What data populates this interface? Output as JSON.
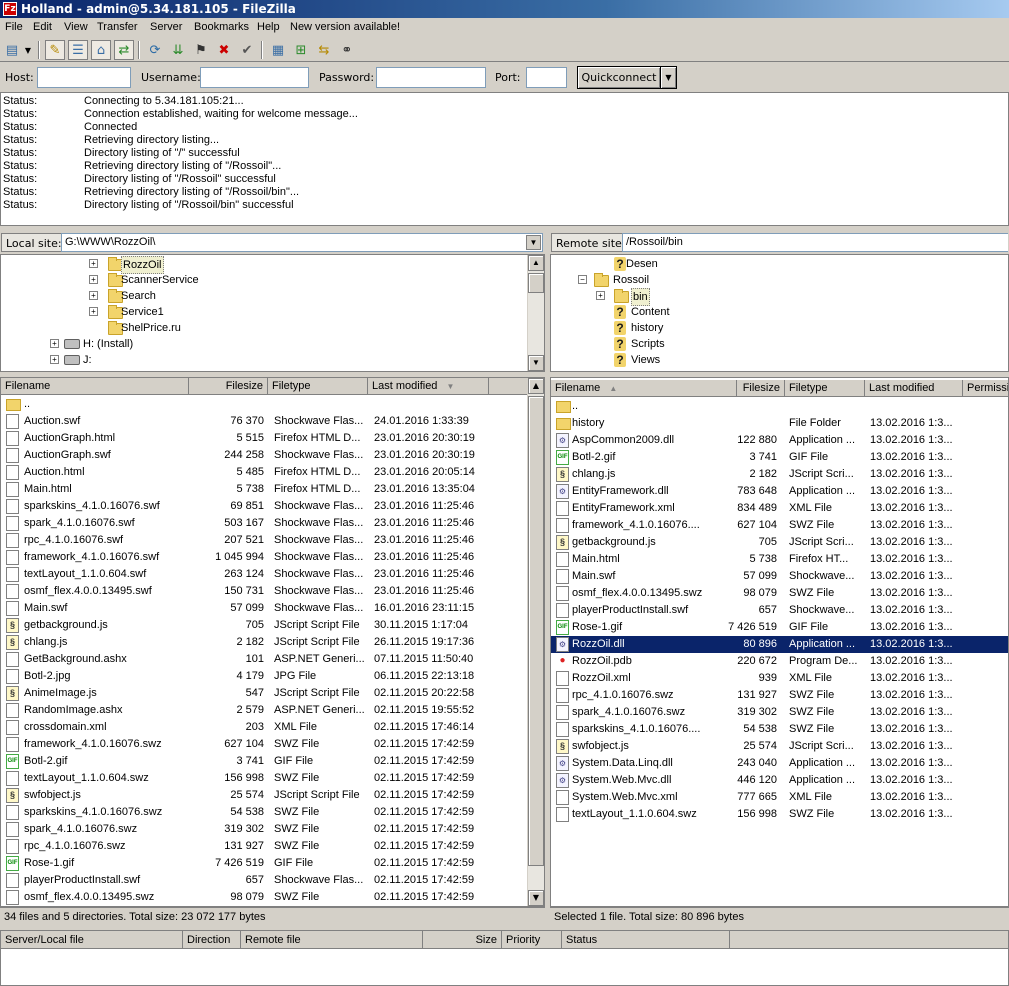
{
  "window": {
    "title": "Holland - admin@5.34.181.105 - FileZilla",
    "icon": "filezilla-icon"
  },
  "menu": [
    "File",
    "Edit",
    "View",
    "Transfer",
    "Server",
    "Bookmarks",
    "Help",
    "New version available!"
  ],
  "toolbar": {
    "icons": [
      "site-manager-icon",
      "dropdown-icon",
      "message-log-icon",
      "local-tree-icon",
      "remote-tree-icon",
      "transfer-queue-icon",
      "refresh-icon",
      "process-queue-icon",
      "cancel-icon",
      "disconnect-icon",
      "reconnect-icon",
      "directory-listing-filters-icon",
      "compare-icon",
      "sync-browse-icon",
      "find-icon"
    ]
  },
  "quickconnect": {
    "host_label": "Host:",
    "host_value": "",
    "username_label": "Username:",
    "username_value": "",
    "password_label": "Password:",
    "password_value": "",
    "port_label": "Port:",
    "port_value": "",
    "button_label": "Quickconnect"
  },
  "log": [
    {
      "key": "Status:",
      "msg": "Connecting to 5.34.181.105:21..."
    },
    {
      "key": "Status:",
      "msg": "Connection established, waiting for welcome message..."
    },
    {
      "key": "Status:",
      "msg": "Connected"
    },
    {
      "key": "Status:",
      "msg": "Retrieving directory listing..."
    },
    {
      "key": "Status:",
      "msg": "Directory listing of \"/\" successful"
    },
    {
      "key": "Status:",
      "msg": "Retrieving directory listing of \"/Rossoil\"..."
    },
    {
      "key": "Status:",
      "msg": "Directory listing of \"/Rossoil\" successful"
    },
    {
      "key": "Status:",
      "msg": "Retrieving directory listing of \"/Rossoil/bin\"..."
    },
    {
      "key": "Status:",
      "msg": "Directory listing of \"/Rossoil/bin\" successful"
    }
  ],
  "local": {
    "site_label": "Local site:",
    "path": "G:\\WWW\\RozzOil\\",
    "tree": [
      {
        "label": "RozzOil",
        "type": "folder",
        "expander": "+",
        "selected": true
      },
      {
        "label": "ScannerService",
        "type": "folder",
        "expander": "+"
      },
      {
        "label": "Search",
        "type": "folder",
        "expander": "+"
      },
      {
        "label": "Service1",
        "type": "folder",
        "expander": "+"
      },
      {
        "label": "ShelPrice.ru",
        "type": "folder",
        "expander": ""
      },
      {
        "label": "H: (Install)",
        "type": "drive",
        "expander": "+"
      },
      {
        "label": "J:",
        "type": "drive",
        "expander": "+"
      }
    ],
    "columns": [
      "Filename",
      "Filesize",
      "Filetype",
      "Last modified"
    ],
    "files": [
      {
        "name": "..",
        "size": "",
        "type": "",
        "modified": "",
        "icon": "folder"
      },
      {
        "name": "Auction.swf",
        "size": "76 370",
        "type": "Shockwave Flas...",
        "modified": "24.01.2016 1:33:39",
        "icon": "file"
      },
      {
        "name": "AuctionGraph.html",
        "size": "5 515",
        "type": "Firefox HTML D...",
        "modified": "23.01.2016 20:30:19",
        "icon": "file"
      },
      {
        "name": "AuctionGraph.swf",
        "size": "244 258",
        "type": "Shockwave Flas...",
        "modified": "23.01.2016 20:30:19",
        "icon": "file"
      },
      {
        "name": "Auction.html",
        "size": "5 485",
        "type": "Firefox HTML D...",
        "modified": "23.01.2016 20:05:14",
        "icon": "file"
      },
      {
        "name": "Main.html",
        "size": "5 738",
        "type": "Firefox HTML D...",
        "modified": "23.01.2016 13:35:04",
        "icon": "file"
      },
      {
        "name": "sparkskins_4.1.0.16076.swf",
        "size": "69 851",
        "type": "Shockwave Flas...",
        "modified": "23.01.2016 11:25:46",
        "icon": "file"
      },
      {
        "name": "spark_4.1.0.16076.swf",
        "size": "503 167",
        "type": "Shockwave Flas...",
        "modified": "23.01.2016 11:25:46",
        "icon": "file"
      },
      {
        "name": "rpc_4.1.0.16076.swf",
        "size": "207 521",
        "type": "Shockwave Flas...",
        "modified": "23.01.2016 11:25:46",
        "icon": "file"
      },
      {
        "name": "framework_4.1.0.16076.swf",
        "size": "1 045 994",
        "type": "Shockwave Flas...",
        "modified": "23.01.2016 11:25:46",
        "icon": "file"
      },
      {
        "name": "textLayout_1.1.0.604.swf",
        "size": "263 124",
        "type": "Shockwave Flas...",
        "modified": "23.01.2016 11:25:46",
        "icon": "file"
      },
      {
        "name": "osmf_flex.4.0.0.13495.swf",
        "size": "150 731",
        "type": "Shockwave Flas...",
        "modified": "23.01.2016 11:25:46",
        "icon": "file"
      },
      {
        "name": "Main.swf",
        "size": "57 099",
        "type": "Shockwave Flas...",
        "modified": "16.01.2016 23:11:15",
        "icon": "file"
      },
      {
        "name": "getbackground.js",
        "size": "705",
        "type": "JScript Script File",
        "modified": "30.11.2015 1:17:04",
        "icon": "js"
      },
      {
        "name": "chlang.js",
        "size": "2 182",
        "type": "JScript Script File",
        "modified": "26.11.2015 19:17:36",
        "icon": "js"
      },
      {
        "name": "GetBackground.ashx",
        "size": "101",
        "type": "ASP.NET Generi...",
        "modified": "07.11.2015 11:50:40",
        "icon": "file"
      },
      {
        "name": "Botl-2.jpg",
        "size": "4 179",
        "type": "JPG File",
        "modified": "06.11.2015 22:13:18",
        "icon": "file"
      },
      {
        "name": "AnimeImage.js",
        "size": "547",
        "type": "JScript Script File",
        "modified": "02.11.2015 20:22:58",
        "icon": "js"
      },
      {
        "name": "RandomImage.ashx",
        "size": "2 579",
        "type": "ASP.NET Generi...",
        "modified": "02.11.2015 19:55:52",
        "icon": "file"
      },
      {
        "name": "crossdomain.xml",
        "size": "203",
        "type": "XML File",
        "modified": "02.11.2015 17:46:14",
        "icon": "file"
      },
      {
        "name": "framework_4.1.0.16076.swz",
        "size": "627 104",
        "type": "SWZ File",
        "modified": "02.11.2015 17:42:59",
        "icon": "file"
      },
      {
        "name": "Botl-2.gif",
        "size": "3 741",
        "type": "GIF File",
        "modified": "02.11.2015 17:42:59",
        "icon": "gif"
      },
      {
        "name": "textLayout_1.1.0.604.swz",
        "size": "156 998",
        "type": "SWZ File",
        "modified": "02.11.2015 17:42:59",
        "icon": "file"
      },
      {
        "name": "swfobject.js",
        "size": "25 574",
        "type": "JScript Script File",
        "modified": "02.11.2015 17:42:59",
        "icon": "js"
      },
      {
        "name": "sparkskins_4.1.0.16076.swz",
        "size": "54 538",
        "type": "SWZ File",
        "modified": "02.11.2015 17:42:59",
        "icon": "file"
      },
      {
        "name": "spark_4.1.0.16076.swz",
        "size": "319 302",
        "type": "SWZ File",
        "modified": "02.11.2015 17:42:59",
        "icon": "file"
      },
      {
        "name": "rpc_4.1.0.16076.swz",
        "size": "131 927",
        "type": "SWZ File",
        "modified": "02.11.2015 17:42:59",
        "icon": "file"
      },
      {
        "name": "Rose-1.gif",
        "size": "7 426 519",
        "type": "GIF File",
        "modified": "02.11.2015 17:42:59",
        "icon": "gif"
      },
      {
        "name": "playerProductInstall.swf",
        "size": "657",
        "type": "Shockwave Flas...",
        "modified": "02.11.2015 17:42:59",
        "icon": "file"
      },
      {
        "name": "osmf_flex.4.0.0.13495.swz",
        "size": "98 079",
        "type": "SWZ File",
        "modified": "02.11.2015 17:42:59",
        "icon": "file"
      }
    ],
    "status": "34 files and 5 directories. Total size: 23 072 177 bytes"
  },
  "remote": {
    "site_label": "Remote site:",
    "path": "/Rossoil/bin",
    "tree": [
      {
        "label": "Desen",
        "type": "unknown",
        "expander": ""
      },
      {
        "label": "Rossoil",
        "type": "folder",
        "expander": "-"
      },
      {
        "label": "bin",
        "type": "folder",
        "expander": "+",
        "selected": true
      },
      {
        "label": "Content",
        "type": "unknown",
        "expander": ""
      },
      {
        "label": "history",
        "type": "unknown",
        "expander": ""
      },
      {
        "label": "Scripts",
        "type": "unknown",
        "expander": ""
      },
      {
        "label": "Views",
        "type": "unknown",
        "expander": ""
      }
    ],
    "columns": [
      "Filename",
      "Filesize",
      "Filetype",
      "Last modified",
      "Permissio"
    ],
    "files": [
      {
        "name": "..",
        "size": "",
        "type": "",
        "modified": "",
        "icon": "folder"
      },
      {
        "name": "history",
        "size": "",
        "type": "File Folder",
        "modified": "13.02.2016 1:3...",
        "icon": "folder"
      },
      {
        "name": "AspCommon2009.dll",
        "size": "122 880",
        "type": "Application ...",
        "modified": "13.02.2016 1:3...",
        "icon": "dll"
      },
      {
        "name": "Botl-2.gif",
        "size": "3 741",
        "type": "GIF File",
        "modified": "13.02.2016 1:3...",
        "icon": "gif"
      },
      {
        "name": "chlang.js",
        "size": "2 182",
        "type": "JScript Scri...",
        "modified": "13.02.2016 1:3...",
        "icon": "js"
      },
      {
        "name": "EntityFramework.dll",
        "size": "783 648",
        "type": "Application ...",
        "modified": "13.02.2016 1:3...",
        "icon": "dll"
      },
      {
        "name": "EntityFramework.xml",
        "size": "834 489",
        "type": "XML File",
        "modified": "13.02.2016 1:3...",
        "icon": "file"
      },
      {
        "name": "framework_4.1.0.16076....",
        "size": "627 104",
        "type": "SWZ File",
        "modified": "13.02.2016 1:3...",
        "icon": "file"
      },
      {
        "name": "getbackground.js",
        "size": "705",
        "type": "JScript Scri...",
        "modified": "13.02.2016 1:3...",
        "icon": "js"
      },
      {
        "name": "Main.html",
        "size": "5 738",
        "type": "Firefox HT...",
        "modified": "13.02.2016 1:3...",
        "icon": "file"
      },
      {
        "name": "Main.swf",
        "size": "57 099",
        "type": "Shockwave...",
        "modified": "13.02.2016 1:3...",
        "icon": "file"
      },
      {
        "name": "osmf_flex.4.0.0.13495.swz",
        "size": "98 079",
        "type": "SWZ File",
        "modified": "13.02.2016 1:3...",
        "icon": "file"
      },
      {
        "name": "playerProductInstall.swf",
        "size": "657",
        "type": "Shockwave...",
        "modified": "13.02.2016 1:3...",
        "icon": "file"
      },
      {
        "name": "Rose-1.gif",
        "size": "7 426 519",
        "type": "GIF File",
        "modified": "13.02.2016 1:3...",
        "icon": "gif"
      },
      {
        "name": "RozzOil.dll",
        "size": "80 896",
        "type": "Application ...",
        "modified": "13.02.2016 1:3...",
        "icon": "dll",
        "selected": true
      },
      {
        "name": "RozzOil.pdb",
        "size": "220 672",
        "type": "Program De...",
        "modified": "13.02.2016 1:3...",
        "icon": "pdb"
      },
      {
        "name": "RozzOil.xml",
        "size": "939",
        "type": "XML File",
        "modified": "13.02.2016 1:3...",
        "icon": "file"
      },
      {
        "name": "rpc_4.1.0.16076.swz",
        "size": "131 927",
        "type": "SWZ File",
        "modified": "13.02.2016 1:3...",
        "icon": "file"
      },
      {
        "name": "spark_4.1.0.16076.swz",
        "size": "319 302",
        "type": "SWZ File",
        "modified": "13.02.2016 1:3...",
        "icon": "file"
      },
      {
        "name": "sparkskins_4.1.0.16076....",
        "size": "54 538",
        "type": "SWZ File",
        "modified": "13.02.2016 1:3...",
        "icon": "file"
      },
      {
        "name": "swfobject.js",
        "size": "25 574",
        "type": "JScript Scri...",
        "modified": "13.02.2016 1:3...",
        "icon": "js"
      },
      {
        "name": "System.Data.Linq.dll",
        "size": "243 040",
        "type": "Application ...",
        "modified": "13.02.2016 1:3...",
        "icon": "dll"
      },
      {
        "name": "System.Web.Mvc.dll",
        "size": "446 120",
        "type": "Application ...",
        "modified": "13.02.2016 1:3...",
        "icon": "dll"
      },
      {
        "name": "System.Web.Mvc.xml",
        "size": "777 665",
        "type": "XML File",
        "modified": "13.02.2016 1:3...",
        "icon": "file"
      },
      {
        "name": "textLayout_1.1.0.604.swz",
        "size": "156 998",
        "type": "SWZ File",
        "modified": "13.02.2016 1:3...",
        "icon": "file"
      }
    ],
    "status": "Selected 1 file. Total size: 80 896 bytes"
  },
  "queue": {
    "columns": [
      "Server/Local file",
      "Direction",
      "Remote file",
      "Size",
      "Priority",
      "Status"
    ]
  },
  "colors": {
    "selection": "#0a246a",
    "titlebar": "#0a246a"
  }
}
